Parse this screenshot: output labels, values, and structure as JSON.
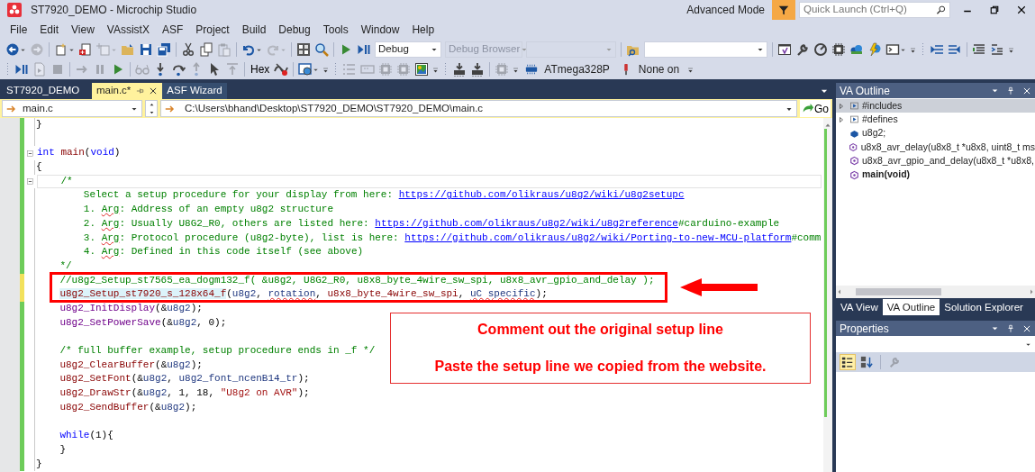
{
  "window": {
    "title": "ST7920_DEMO - Microchip Studio",
    "mode": "Advanced Mode",
    "quick_launch": {
      "placeholder": "Quick Launch (Ctrl+Q)"
    }
  },
  "menu": [
    "File",
    "Edit",
    "View",
    "VAssistX",
    "ASF",
    "Project",
    "Build",
    "Debug",
    "Tools",
    "Window",
    "Help"
  ],
  "toolbar_1": [
    {
      "kind": "button",
      "disabled": false,
      "has_menu": true
    },
    {
      "kind": "button",
      "disabled": true,
      "has_menu": false
    },
    {
      "kind": "separator"
    },
    {
      "kind": "button",
      "disabled": false,
      "has_menu": true
    },
    {
      "kind": "button",
      "disabled": false,
      "has_menu": false
    },
    {
      "kind": "button",
      "disabled": true,
      "has_menu": true
    },
    {
      "kind": "button",
      "disabled": false,
      "has_menu": false
    },
    {
      "kind": "button",
      "disabled": false,
      "has_menu": false
    },
    {
      "kind": "button",
      "disabled": false,
      "has_menu": false
    },
    {
      "kind": "separator"
    },
    {
      "kind": "button",
      "disabled": false,
      "has_menu": false
    },
    {
      "kind": "button",
      "disabled": false,
      "has_menu": false
    },
    {
      "kind": "button",
      "disabled": true,
      "has_menu": false
    },
    {
      "kind": "separator"
    },
    {
      "kind": "button",
      "disabled": false,
      "has_menu": true
    },
    {
      "kind": "button",
      "disabled": true,
      "has_menu": true
    },
    {
      "kind": "separator"
    },
    {
      "kind": "button",
      "disabled": false,
      "has_menu": false
    },
    {
      "kind": "button",
      "disabled": false,
      "has_menu": false
    },
    {
      "kind": "separator"
    },
    {
      "kind": "button",
      "disabled": false,
      "has_menu": false
    },
    {
      "kind": "button",
      "disabled": false,
      "has_menu": false
    },
    {
      "kind": "dropdown",
      "value": "Debug",
      "disabled": false
    },
    {
      "kind": "dropdown",
      "value": "Debug Browser",
      "disabled": true
    },
    {
      "kind": "dropdown",
      "disabled": true
    },
    {
      "kind": "separator"
    },
    {
      "kind": "button",
      "disabled": false,
      "has_menu": false
    },
    {
      "kind": "dropdown",
      "disabled": false
    },
    {
      "kind": "separator"
    },
    {
      "kind": "button",
      "disabled": false,
      "has_menu": false
    },
    {
      "kind": "button",
      "disabled": false,
      "has_menu": false
    },
    {
      "kind": "button",
      "disabled": false,
      "has_menu": false
    },
    {
      "kind": "button",
      "disabled": false,
      "has_menu": false
    },
    {
      "kind": "button",
      "disabled": false,
      "has_menu": false
    },
    {
      "kind": "button",
      "disabled": false,
      "has_menu": false
    },
    {
      "kind": "button",
      "disabled": false,
      "has_menu": true
    },
    {
      "kind": "overflow"
    },
    {
      "kind": "grip"
    },
    {
      "kind": "button",
      "disabled": false,
      "has_menu": false
    },
    {
      "kind": "button",
      "disabled": false,
      "has_menu": false
    },
    {
      "kind": "separator"
    },
    {
      "kind": "button",
      "disabled": false,
      "has_menu": false
    },
    {
      "kind": "button",
      "disabled": false,
      "has_menu": false
    },
    {
      "kind": "overflow"
    }
  ],
  "toolbar_2": [
    {
      "kind": "grip"
    },
    {
      "kind": "button",
      "disabled": false,
      "has_menu": false
    },
    {
      "kind": "button",
      "disabled": true,
      "has_menu": false
    },
    {
      "kind": "button",
      "disabled": true,
      "has_menu": false
    },
    {
      "kind": "separator"
    },
    {
      "kind": "button",
      "disabled": true,
      "has_menu": false
    },
    {
      "kind": "button",
      "disabled": true,
      "has_menu": false
    },
    {
      "kind": "button",
      "disabled": false,
      "has_menu": false
    },
    {
      "kind": "separator"
    },
    {
      "kind": "button",
      "disabled": true,
      "has_menu": false
    },
    {
      "kind": "button",
      "disabled": false,
      "has_menu": false
    },
    {
      "kind": "button",
      "disabled": false,
      "has_menu": false
    },
    {
      "kind": "button",
      "disabled": true,
      "has_menu": false
    },
    {
      "kind": "button",
      "disabled": false,
      "has_menu": false
    },
    {
      "kind": "button",
      "disabled": true,
      "has_menu": false
    },
    {
      "kind": "separator"
    },
    {
      "kind": "text",
      "label": "Hex"
    },
    {
      "kind": "button",
      "disabled": false,
      "has_menu": false
    },
    {
      "kind": "separator"
    },
    {
      "kind": "button",
      "disabled": false,
      "has_menu": true
    },
    {
      "kind": "overflow"
    },
    {
      "kind": "grip"
    },
    {
      "kind": "button",
      "disabled": true,
      "has_menu": false
    },
    {
      "kind": "button",
      "disabled": true,
      "has_menu": false
    },
    {
      "kind": "button",
      "disabled": true,
      "has_menu": false
    },
    {
      "kind": "button",
      "disabled": true,
      "has_menu": false
    },
    {
      "kind": "button",
      "disabled": false,
      "has_menu": false
    },
    {
      "kind": "overflow"
    },
    {
      "kind": "grip"
    },
    {
      "kind": "button",
      "disabled": false,
      "has_menu": false
    },
    {
      "kind": "button",
      "disabled": false,
      "has_menu": false
    },
    {
      "kind": "separator"
    },
    {
      "kind": "button",
      "disabled": true,
      "has_menu": false
    },
    {
      "kind": "overflow"
    },
    {
      "kind": "labeled",
      "label": "ATmega328P"
    },
    {
      "kind": "labeled",
      "label": "None on"
    },
    {
      "kind": "overflow"
    }
  ],
  "document_tabs": [
    {
      "label": "ST7920_DEMO",
      "selected": false
    },
    {
      "label": "main.c*",
      "selected": true
    },
    {
      "label": "ASF Wizard",
      "selected": false
    }
  ],
  "navigation": {
    "scope": "main.c",
    "path": "C:\\Users\\bhand\\Desktop\\ST7920_DEMO\\ST7920_DEMO\\main.c",
    "go_label": "Go"
  },
  "editor": {
    "sections": [
      {
        "kind": "plain",
        "lines": [
          {
            "kind": "code",
            "unsaved": false,
            "fold": false,
            "tokens": [
              {
                "kind": "plain",
                "text": "}"
              }
            ]
          },
          {
            "kind": "code",
            "unsaved": false,
            "fold": false
          },
          {
            "kind": "code",
            "unsaved": false,
            "fold": true,
            "tokens": [
              {
                "kind": "keyword",
                "text": "int"
              },
              {
                "kind": "function",
                "text": " main"
              },
              {
                "kind": "plain",
                "text": "("
              },
              {
                "kind": "keyword",
                "text": "void"
              },
              {
                "kind": "plain",
                "text": ")"
              }
            ]
          },
          {
            "kind": "code",
            "unsaved": false,
            "fold": false,
            "tokens": [
              {
                "kind": "plain",
                "text": "{"
              }
            ]
          },
          {
            "kind": "current",
            "unsaved": false,
            "fold": true,
            "tokens": [
              {
                "kind": "comment",
                "text": "    /*"
              }
            ]
          },
          {
            "kind": "code",
            "unsaved": false,
            "fold": false,
            "tokens": [
              {
                "kind": "comment",
                "text": "        Select a setup procedure for your display from here: "
              },
              {
                "kind": "link",
                "text": "https://github.com/olikraus/u8g2/wiki/u8g2setupc"
              }
            ]
          },
          {
            "kind": "code",
            "unsaved": false,
            "fold": false,
            "tokens": [
              {
                "kind": "comment",
                "text": "        1. "
              },
              {
                "kind": "typo",
                "text": "Arg"
              },
              {
                "kind": "comment",
                "text": ": Address of an empty u8g2 structure"
              }
            ]
          },
          {
            "kind": "code",
            "unsaved": false,
            "fold": false,
            "tokens": [
              {
                "kind": "comment",
                "text": "        2. "
              },
              {
                "kind": "typo",
                "text": "Arg"
              },
              {
                "kind": "comment",
                "text": ": Usually U8G2_R0, others are listed here: "
              },
              {
                "kind": "link",
                "text": "https://github.com/olikraus/u8g2/wiki/u8g2reference"
              },
              {
                "kind": "comment",
                "text": "#carduino-example"
              }
            ]
          },
          {
            "kind": "code",
            "unsaved": false,
            "fold": false,
            "tokens": [
              {
                "kind": "comment",
                "text": "        3. "
              },
              {
                "kind": "typo",
                "text": "Arg"
              },
              {
                "kind": "comment",
                "text": ": Protocol procedure (u8g2-byte), list is here: "
              },
              {
                "kind": "link",
                "text": "https://github.com/olikraus/u8g2/wiki/Porting-to-new-MCU-platform"
              },
              {
                "kind": "comment",
                "text": "#comm"
              }
            ]
          },
          {
            "kind": "code",
            "unsaved": false,
            "fold": false,
            "tokens": [
              {
                "kind": "comment",
                "text": "        4. "
              },
              {
                "kind": "typo",
                "text": "Arg"
              },
              {
                "kind": "comment",
                "text": ": Defined in this code itself (see above)"
              }
            ]
          },
          {
            "kind": "code",
            "unsaved": false,
            "fold": false,
            "tokens": [
              {
                "kind": "comment",
                "text": "    */"
              }
            ]
          }
        ]
      },
      {
        "kind": "framed",
        "lines": [
          {
            "kind": "code",
            "unsaved": true,
            "fold": false,
            "tokens": [
              {
                "kind": "comment",
                "text": "    //u8g2_Setup_st7565_ea_dogm132_f( &u8g2, U8G2_R0, u8x8_byte_4wire_sw_spi, u8x8_avr_gpio_and_delay );"
              }
            ]
          },
          {
            "kind": "code",
            "unsaved": true,
            "fold": false,
            "tokens": [
              {
                "kind": "highlight",
                "text": "    u8g2_Setup_st7920_s_128x64_f"
              },
              {
                "kind": "plain",
                "text": "("
              },
              {
                "kind": "variable",
                "text": "u8g2"
              },
              {
                "kind": "plain",
                "text": ", "
              },
              {
                "kind": "error",
                "text": "rotation"
              },
              {
                "kind": "plain",
                "text": ", "
              },
              {
                "kind": "function",
                "text": "u8x8_byte_4wire_sw_spi"
              },
              {
                "kind": "plain",
                "text": ", "
              },
              {
                "kind": "error",
                "text": "uC specific"
              },
              {
                "kind": "plain",
                "text": ");"
              }
            ]
          }
        ]
      },
      {
        "kind": "plain",
        "lines": [
          {
            "kind": "code",
            "unsaved": false,
            "fold": false,
            "tokens": [
              {
                "kind": "macro",
                "text": "    u8g2_InitDisplay"
              },
              {
                "kind": "plain",
                "text": "(&"
              },
              {
                "kind": "variable",
                "text": "u8g2"
              },
              {
                "kind": "plain",
                "text": ");"
              }
            ]
          },
          {
            "kind": "code",
            "unsaved": false,
            "fold": false,
            "tokens": [
              {
                "kind": "macro",
                "text": "    u8g2_SetPowerSave"
              },
              {
                "kind": "plain",
                "text": "(&"
              },
              {
                "kind": "variable",
                "text": "u8g2"
              },
              {
                "kind": "plain",
                "text": ", 0);"
              }
            ]
          },
          {
            "kind": "code",
            "unsaved": false,
            "fold": false
          },
          {
            "kind": "code",
            "unsaved": false,
            "fold": false,
            "tokens": [
              {
                "kind": "comment",
                "text": "    /* full buffer example, setup procedure ends in _f */"
              }
            ]
          },
          {
            "kind": "code",
            "unsaved": false,
            "fold": false,
            "tokens": [
              {
                "kind": "function",
                "text": "    u8g2_ClearBuffer"
              },
              {
                "kind": "plain",
                "text": "(&"
              },
              {
                "kind": "variable",
                "text": "u8g2"
              },
              {
                "kind": "plain",
                "text": ");"
              }
            ]
          },
          {
            "kind": "code",
            "unsaved": false,
            "fold": false,
            "tokens": [
              {
                "kind": "function",
                "text": "    u8g2_SetFont"
              },
              {
                "kind": "plain",
                "text": "(&"
              },
              {
                "kind": "variable",
                "text": "u8g2"
              },
              {
                "kind": "plain",
                "text": ", "
              },
              {
                "kind": "variable",
                "text": "u8g2_font_ncenB14_tr"
              },
              {
                "kind": "plain",
                "text": ");"
              }
            ]
          },
          {
            "kind": "code",
            "unsaved": false,
            "fold": false,
            "tokens": [
              {
                "kind": "function",
                "text": "    u8g2_DrawStr"
              },
              {
                "kind": "plain",
                "text": "(&"
              },
              {
                "kind": "variable",
                "text": "u8g2"
              },
              {
                "kind": "plain",
                "text": ", 1, 18, "
              },
              {
                "kind": "string",
                "text": "\"U8g2 on AVR\""
              },
              {
                "kind": "plain",
                "text": ");"
              }
            ]
          },
          {
            "kind": "code",
            "unsaved": false,
            "fold": false,
            "tokens": [
              {
                "kind": "function",
                "text": "    u8g2_SendBuffer"
              },
              {
                "kind": "plain",
                "text": "(&"
              },
              {
                "kind": "variable",
                "text": "u8g2"
              },
              {
                "kind": "plain",
                "text": ");"
              }
            ]
          },
          {
            "kind": "code",
            "unsaved": false,
            "fold": false
          },
          {
            "kind": "code",
            "unsaved": false,
            "fold": false,
            "tokens": [
              {
                "kind": "keyword",
                "text": "    while"
              },
              {
                "kind": "plain",
                "text": "(1){"
              }
            ]
          },
          {
            "kind": "code",
            "unsaved": false,
            "fold": false,
            "tokens": [
              {
                "kind": "plain",
                "text": "    }"
              }
            ]
          },
          {
            "kind": "code",
            "unsaved": false,
            "fold": false,
            "tokens": [
              {
                "kind": "plain",
                "text": "}"
              }
            ]
          }
        ]
      }
    ]
  },
  "annotation": {
    "callout": [
      "Comment out the original setup line",
      "Paste the setup line we copied from the website."
    ]
  },
  "va_outline": {
    "title": "VA Outline",
    "items": [
      {
        "kind": "group",
        "label": "#includes",
        "expanded": false,
        "selected": true,
        "current": false
      },
      {
        "kind": "group",
        "label": "#defines",
        "expanded": false,
        "selected": false,
        "current": false
      },
      {
        "kind": "variable",
        "label": "u8g2;",
        "selected": false,
        "current": false
      },
      {
        "kind": "function",
        "label": "u8x8_avr_delay(u8x8_t *u8x8, uint8_t ms",
        "selected": false,
        "current": false
      },
      {
        "kind": "function",
        "label": "u8x8_avr_gpio_and_delay(u8x8_t *u8x8,",
        "selected": false,
        "current": false
      },
      {
        "kind": "function",
        "label": "main(void)",
        "selected": false,
        "current": true
      }
    ],
    "tabs": [
      {
        "label": "VA View",
        "selected": false
      },
      {
        "label": "VA Outline",
        "selected": true
      },
      {
        "label": "Solution Explorer",
        "selected": false
      }
    ]
  },
  "properties": {
    "title": "Properties",
    "tools": [
      {
        "selected": true,
        "disabled": false
      },
      {
        "selected": false,
        "disabled": false
      },
      {
        "selected": false,
        "disabled": true
      }
    ]
  }
}
